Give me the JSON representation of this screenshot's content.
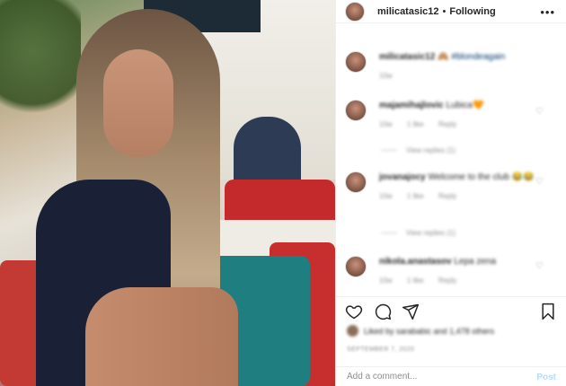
{
  "post": {
    "username": "milicatasic12",
    "separator": "•",
    "follow_status": "Following",
    "more_icon": "more-horizontal-icon"
  },
  "comments": [
    {
      "user": "milicatasic12",
      "text": "🙈 #blondeagain",
      "time": "10w",
      "likes": "",
      "reply": ""
    },
    {
      "user": "majamihajlovic",
      "text": "Lubica🧡",
      "time": "10w",
      "likes": "1 like",
      "reply": "Reply",
      "view_replies": "View replies (1)"
    },
    {
      "user": "jovanajocy",
      "text": "Welcome to the club 😂😂",
      "time": "10w",
      "likes": "1 like",
      "reply": "Reply",
      "view_replies": "View replies (1)"
    },
    {
      "user": "nikola.anastasov",
      "text": "Lepa zena",
      "time": "10w",
      "likes": "1 like",
      "reply": "Reply"
    }
  ],
  "actions": {
    "like_icon": "heart-icon",
    "comment_icon": "comment-icon",
    "share_icon": "share-icon",
    "save_icon": "bookmark-icon"
  },
  "likes_text": "Liked by sarababic and 1,478 others",
  "date": "SEPTEMBER 7, 2020",
  "comment_input": {
    "placeholder": "Add a comment...",
    "post_label": "Post"
  }
}
